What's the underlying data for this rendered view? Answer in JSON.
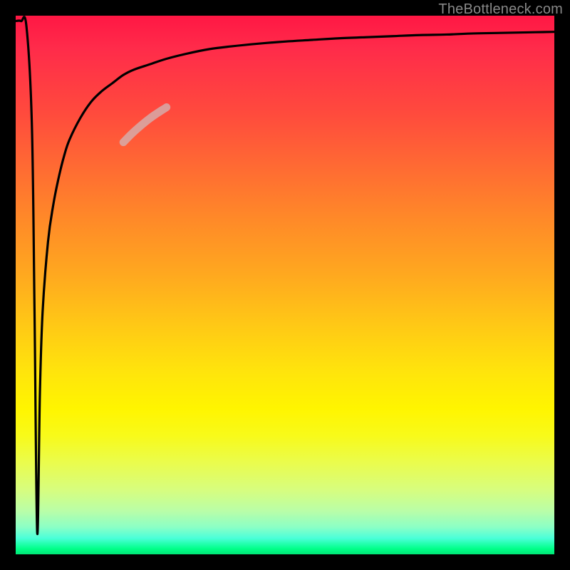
{
  "attribution": "TheBottleneck.com",
  "chart_data": {
    "type": "line",
    "title": "",
    "xlabel": "",
    "ylabel": "",
    "x_range": [
      0,
      100
    ],
    "y_range": [
      0,
      100
    ],
    "background_gradient_meaning": "bottleneck severity (red=high, green=low)",
    "series": [
      {
        "name": "bottleneck-curve",
        "description": "Sharp dip near x≈4 to y≈4, asymptotic rise toward y≈97",
        "x": [
          0,
          1,
          2,
          3,
          3.5,
          4,
          4.5,
          5,
          6,
          7,
          8,
          9,
          10,
          12,
          14,
          16,
          18,
          20,
          22,
          25,
          28,
          32,
          36,
          40,
          45,
          50,
          55,
          60,
          65,
          70,
          75,
          80,
          85,
          90,
          95,
          100
        ],
        "y": [
          99,
          99,
          98,
          80,
          45,
          4,
          30,
          45,
          58,
          65,
          70,
          74,
          77,
          81,
          84,
          86,
          87.5,
          89,
          90,
          91,
          92,
          93,
          93.8,
          94.3,
          94.8,
          95.2,
          95.5,
          95.8,
          96.0,
          96.2,
          96.4,
          96.5,
          96.7,
          96.8,
          96.9,
          97.0
        ]
      },
      {
        "name": "highlight-segment",
        "description": "Faded/thick overlay segment on the rising curve",
        "x": [
          20,
          22,
          25,
          28
        ],
        "y": [
          76.5,
          78.5,
          81,
          83
        ]
      }
    ]
  }
}
